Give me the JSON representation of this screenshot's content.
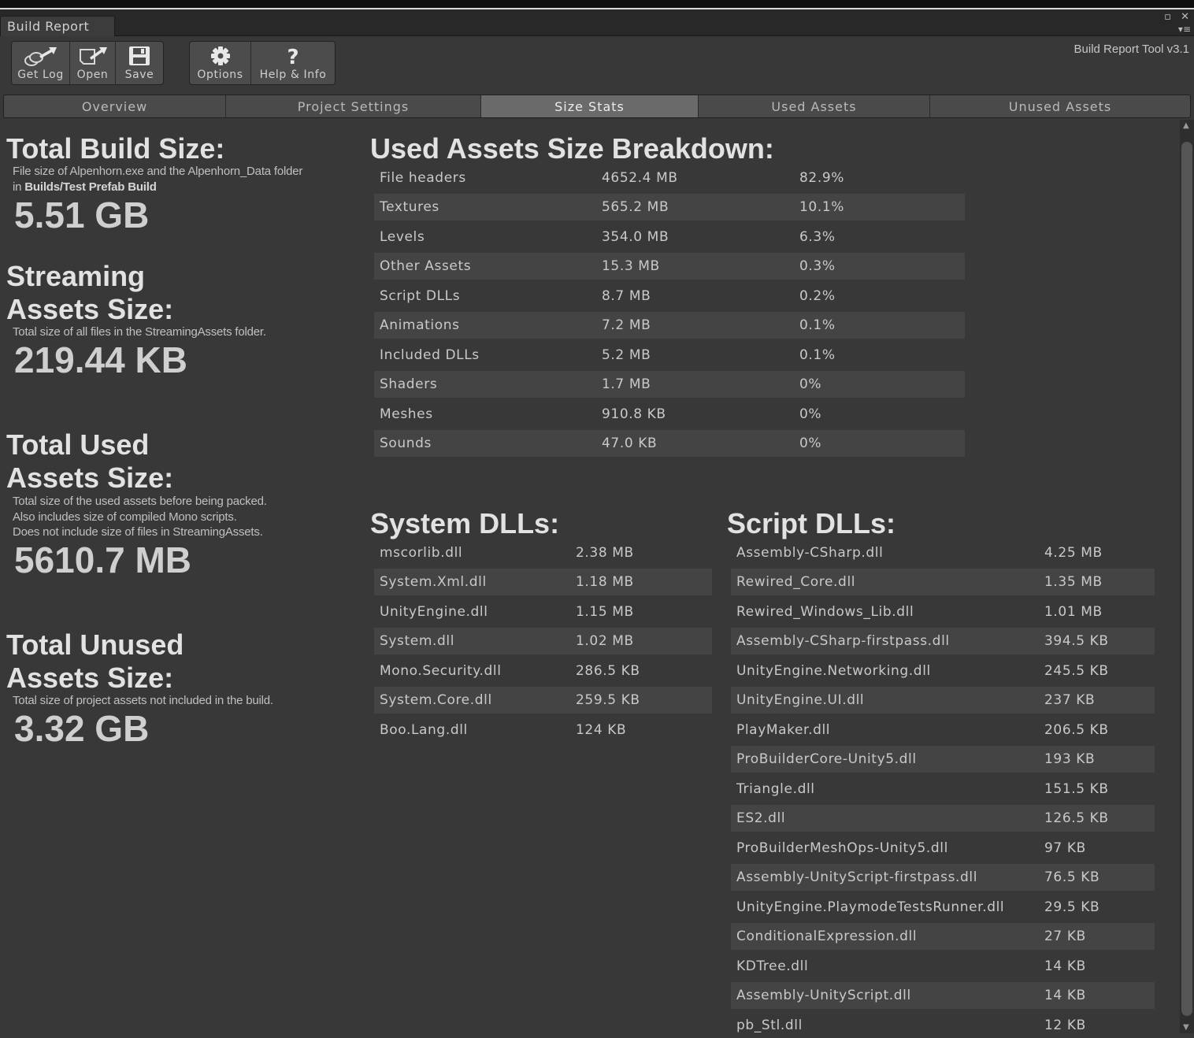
{
  "window": {
    "tab_title": "Build Report",
    "controls": [
      "▫",
      "✕"
    ],
    "menu_glyph": "▾≡"
  },
  "toolbar": {
    "buttons": [
      {
        "label": "Get Log",
        "icon": "get-log-icon"
      },
      {
        "label": "Open",
        "icon": "open-icon"
      },
      {
        "label": "Save",
        "icon": "save-icon"
      },
      {
        "label": "Options",
        "icon": "gear-icon"
      },
      {
        "label": "Help & Info",
        "icon": "help-icon"
      }
    ],
    "version": "Build Report Tool v3.1"
  },
  "tabs": [
    {
      "label": "Overview",
      "active": false
    },
    {
      "label": "Project Settings",
      "active": false
    },
    {
      "label": "Size Stats",
      "active": true
    },
    {
      "label": "Used Assets",
      "active": false
    },
    {
      "label": "Unused Assets",
      "active": false
    }
  ],
  "left": {
    "total_build": {
      "title": "Total Build Size:",
      "desc_line1": "File size of Alpenhorn.exe and the Alpenhorn_Data folder",
      "desc_line2_prefix": "in ",
      "desc_line2_path": "Builds/Test Prefab Build",
      "value": "5.51 GB"
    },
    "streaming": {
      "title_line1": "Streaming",
      "title_line2": "Assets Size:",
      "desc": "Total size of all files in the StreamingAssets folder.",
      "value": "219.44 KB"
    },
    "used": {
      "title_line1": "Total Used",
      "title_line2": "Assets Size:",
      "desc_line1": "Total size of the used assets before being packed.",
      "desc_line2": "Also includes size of compiled Mono scripts.",
      "desc_line3": "Does not include size of files in StreamingAssets.",
      "value": "5610.7 MB"
    },
    "unused": {
      "title_line1": "Total Unused",
      "title_line2": "Assets Size:",
      "desc": "Total size of project assets not included in the build.",
      "value": "3.32 GB"
    }
  },
  "breakdown": {
    "title": "Used Assets Size Breakdown:",
    "rows": [
      {
        "name": "File headers",
        "size": "4652.4 MB",
        "pct": "82.9%"
      },
      {
        "name": "Textures",
        "size": "565.2 MB",
        "pct": "10.1%"
      },
      {
        "name": "Levels",
        "size": "354.0 MB",
        "pct": "6.3%"
      },
      {
        "name": "Other Assets",
        "size": "15.3 MB",
        "pct": "0.3%"
      },
      {
        "name": "Script DLLs",
        "size": "8.7 MB",
        "pct": "0.2%"
      },
      {
        "name": "Animations",
        "size": "7.2 MB",
        "pct": "0.1%"
      },
      {
        "name": "Included DLLs",
        "size": "5.2 MB",
        "pct": "0.1%"
      },
      {
        "name": "Shaders",
        "size": "1.7 MB",
        "pct": "0%"
      },
      {
        "name": "Meshes",
        "size": "910.8 KB",
        "pct": "0%"
      },
      {
        "name": "Sounds",
        "size": "47.0 KB",
        "pct": "0%"
      }
    ]
  },
  "system_dlls": {
    "title": "System DLLs:",
    "rows": [
      {
        "name": "mscorlib.dll",
        "size": "2.38 MB"
      },
      {
        "name": "System.Xml.dll",
        "size": "1.18 MB"
      },
      {
        "name": "UnityEngine.dll",
        "size": "1.15 MB"
      },
      {
        "name": "System.dll",
        "size": "1.02 MB"
      },
      {
        "name": "Mono.Security.dll",
        "size": "286.5 KB"
      },
      {
        "name": "System.Core.dll",
        "size": "259.5 KB"
      },
      {
        "name": "Boo.Lang.dll",
        "size": "124 KB"
      }
    ]
  },
  "script_dlls": {
    "title": "Script DLLs:",
    "rows": [
      {
        "name": "Assembly-CSharp.dll",
        "size": "4.25 MB"
      },
      {
        "name": "Rewired_Core.dll",
        "size": "1.35 MB"
      },
      {
        "name": "Rewired_Windows_Lib.dll",
        "size": "1.01 MB"
      },
      {
        "name": "Assembly-CSharp-firstpass.dll",
        "size": "394.5 KB"
      },
      {
        "name": "UnityEngine.Networking.dll",
        "size": "245.5 KB"
      },
      {
        "name": "UnityEngine.UI.dll",
        "size": "237 KB"
      },
      {
        "name": "PlayMaker.dll",
        "size": "206.5 KB"
      },
      {
        "name": "ProBuilderCore-Unity5.dll",
        "size": "193 KB"
      },
      {
        "name": "Triangle.dll",
        "size": "151.5 KB"
      },
      {
        "name": "ES2.dll",
        "size": "126.5 KB"
      },
      {
        "name": "ProBuilderMeshOps-Unity5.dll",
        "size": "97 KB"
      },
      {
        "name": "Assembly-UnityScript-firstpass.dll",
        "size": "76.5 KB"
      },
      {
        "name": "UnityEngine.PlaymodeTestsRunner.dll",
        "size": "29.5 KB"
      },
      {
        "name": "ConditionalExpression.dll",
        "size": "27 KB"
      },
      {
        "name": "KDTree.dll",
        "size": "14 KB"
      },
      {
        "name": "Assembly-UnityScript.dll",
        "size": "14 KB"
      },
      {
        "name": "pb_Stl.dll",
        "size": "12 KB"
      }
    ]
  }
}
